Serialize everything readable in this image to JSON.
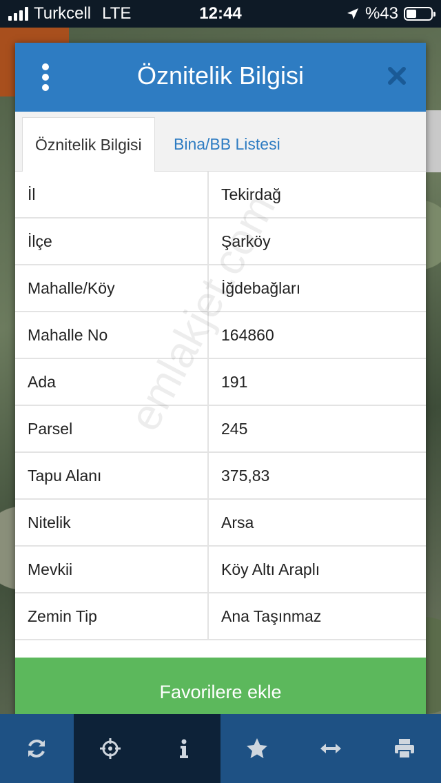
{
  "status_bar": {
    "carrier": "Turkcell",
    "network": "LTE",
    "time": "12:44",
    "battery_text": "%43"
  },
  "dialog": {
    "title": "Öznitelik Bilgisi",
    "tabs": [
      {
        "label": "Öznitelik Bilgisi",
        "active": true
      },
      {
        "label": "Bina/BB Listesi",
        "active": false
      }
    ],
    "rows": [
      {
        "key": "İl",
        "value": "Tekirdağ"
      },
      {
        "key": "İlçe",
        "value": "Şarköy"
      },
      {
        "key": "Mahalle/Köy",
        "value": "İğdebağları"
      },
      {
        "key": "Mahalle No",
        "value": "164860"
      },
      {
        "key": "Ada",
        "value": "191"
      },
      {
        "key": "Parsel",
        "value": "245"
      },
      {
        "key": "Tapu Alanı",
        "value": "375,83"
      },
      {
        "key": "Nitelik",
        "value": "Arsa"
      },
      {
        "key": "Mevkii",
        "value": "Köy Altı Araplı"
      },
      {
        "key": "Zemin Tip",
        "value": "Ana Taşınmaz"
      }
    ],
    "favorite_button": "Favorilere ekle",
    "watermark": "emlakjet.com"
  },
  "toolbar": {
    "icons": [
      "refresh-icon",
      "crosshair-icon",
      "info-icon",
      "star-icon",
      "arrows-horizontal-icon",
      "print-icon"
    ]
  },
  "colors": {
    "header_blue": "#2e7cc2",
    "button_green": "#5cb85c",
    "toolbar_blue": "#1e5184",
    "toolbar_dark": "#0d2238"
  }
}
